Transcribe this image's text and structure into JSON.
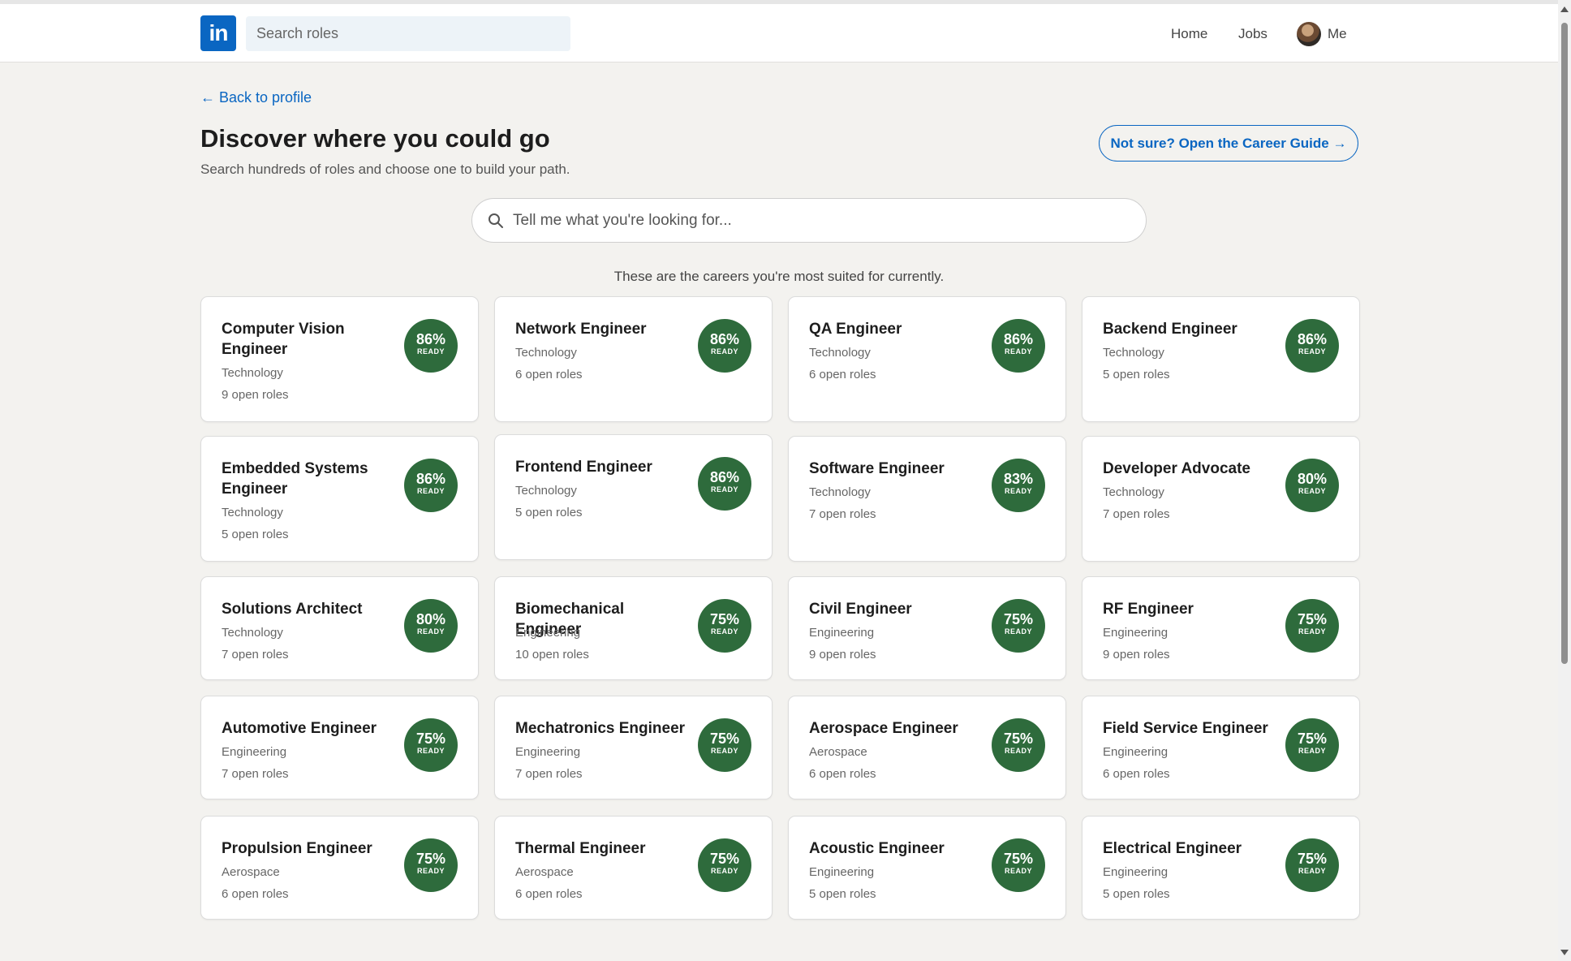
{
  "header": {
    "logo_text": "in",
    "search_placeholder": "Search roles",
    "nav": {
      "home": "Home",
      "jobs": "Jobs",
      "me": "Me"
    }
  },
  "page": {
    "back_link": "← Back to profile",
    "title": "Discover where you could go",
    "subtitle": "Search hundreds of roles and choose one to build your path.",
    "guide_button": "Not sure? Open the Career Guide →",
    "search_placeholder": "Tell me what you're looking for...",
    "suited_text": "These are the careers you're most suited for currently."
  },
  "badge_suffix": "READY",
  "colors": {
    "accent": "#0a66c2",
    "badge": "#2e6b3c",
    "background": "#f3f2ef"
  },
  "cards": [
    {
      "title": "Computer Vision Engineer",
      "category": "Technology",
      "open_roles": "9 open roles",
      "readiness": "86%"
    },
    {
      "title": "Network Engineer",
      "category": "Technology",
      "open_roles": "6 open roles",
      "readiness": "86%"
    },
    {
      "title": "QA Engineer",
      "category": "Technology",
      "open_roles": "6 open roles",
      "readiness": "86%"
    },
    {
      "title": "Backend Engineer",
      "category": "Technology",
      "open_roles": "5 open roles",
      "readiness": "86%"
    },
    {
      "title": "Embedded Systems Engineer",
      "category": "Technology",
      "open_roles": "5 open roles",
      "readiness": "86%"
    },
    {
      "title": "Frontend Engineer",
      "category": "Technology",
      "open_roles": "5 open roles",
      "readiness": "86%"
    },
    {
      "title": "Software Engineer",
      "category": "Technology",
      "open_roles": "7 open roles",
      "readiness": "83%"
    },
    {
      "title": "Developer Advocate",
      "category": "Technology",
      "open_roles": "7 open roles",
      "readiness": "80%"
    },
    {
      "title": "Solutions Architect",
      "category": "Technology",
      "open_roles": "7 open roles",
      "readiness": "80%"
    },
    {
      "title": "Biomechanical Engineer",
      "category": "Engineering",
      "open_roles": "10 open roles",
      "readiness": "75%"
    },
    {
      "title": "Civil Engineer",
      "category": "Engineering",
      "open_roles": "9 open roles",
      "readiness": "75%"
    },
    {
      "title": "RF Engineer",
      "category": "Engineering",
      "open_roles": "9 open roles",
      "readiness": "75%"
    },
    {
      "title": "Automotive Engineer",
      "category": "Engineering",
      "open_roles": "7 open roles",
      "readiness": "75%"
    },
    {
      "title": "Mechatronics Engineer",
      "category": "Engineering",
      "open_roles": "7 open roles",
      "readiness": "75%"
    },
    {
      "title": "Aerospace Engineer",
      "category": "Aerospace",
      "open_roles": "6 open roles",
      "readiness": "75%"
    },
    {
      "title": "Field Service Engineer",
      "category": "Engineering",
      "open_roles": "6 open roles",
      "readiness": "75%"
    },
    {
      "title": "Propulsion Engineer",
      "category": "Aerospace",
      "open_roles": "6 open roles",
      "readiness": "75%"
    },
    {
      "title": "Thermal Engineer",
      "category": "Aerospace",
      "open_roles": "6 open roles",
      "readiness": "75%"
    },
    {
      "title": "Acoustic Engineer",
      "category": "Engineering",
      "open_roles": "5 open roles",
      "readiness": "75%"
    },
    {
      "title": "Electrical Engineer",
      "category": "Engineering",
      "open_roles": "5 open roles",
      "readiness": "75%"
    }
  ]
}
